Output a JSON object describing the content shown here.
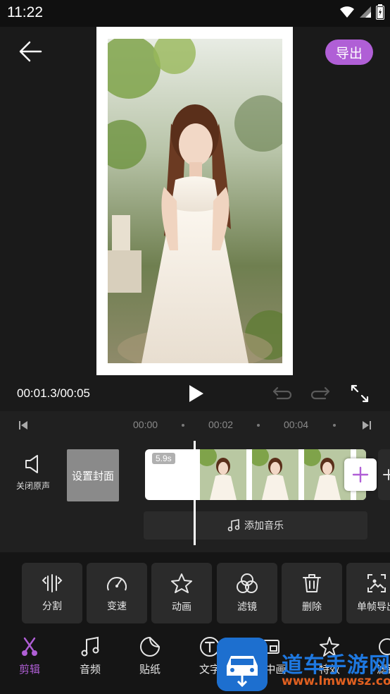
{
  "status_bar": {
    "time": "11:22"
  },
  "header": {
    "export_label": "导出"
  },
  "player": {
    "time_readout": "00:01.3/00:05"
  },
  "timeline": {
    "ruler_labels": [
      "00:00",
      "00:02",
      "00:04"
    ],
    "mute_label": "关闭原声",
    "cover_label": "设置封面",
    "clip_duration": "5.9s",
    "music_label": "添加音乐"
  },
  "tools": [
    {
      "label": "分割",
      "icon": "split-icon"
    },
    {
      "label": "变速",
      "icon": "speedometer-icon"
    },
    {
      "label": "动画",
      "icon": "star-icon"
    },
    {
      "label": "滤镜",
      "icon": "filter-circles-icon"
    },
    {
      "label": "删除",
      "icon": "trash-icon"
    },
    {
      "label": "单帧导出",
      "icon": "frame-export-icon"
    }
  ],
  "nav": [
    {
      "label": "剪辑",
      "icon": "scissors-icon"
    },
    {
      "label": "音频",
      "icon": "music-note-icon"
    },
    {
      "label": "贴纸",
      "icon": "sticker-icon"
    },
    {
      "label": "文字",
      "icon": "text-icon"
    },
    {
      "label": "画中画",
      "icon": "picture-in-picture-icon"
    },
    {
      "label": "特效",
      "icon": "effects-star-icon"
    },
    {
      "label": "滤镜",
      "icon": "filter-icon"
    }
  ],
  "watermark": {
    "title": "道车手游网",
    "url": "www.lmwwsz.com"
  },
  "colors": {
    "accent": "#b05fd6",
    "background": "#151515",
    "panel": "#2b2b2b"
  }
}
